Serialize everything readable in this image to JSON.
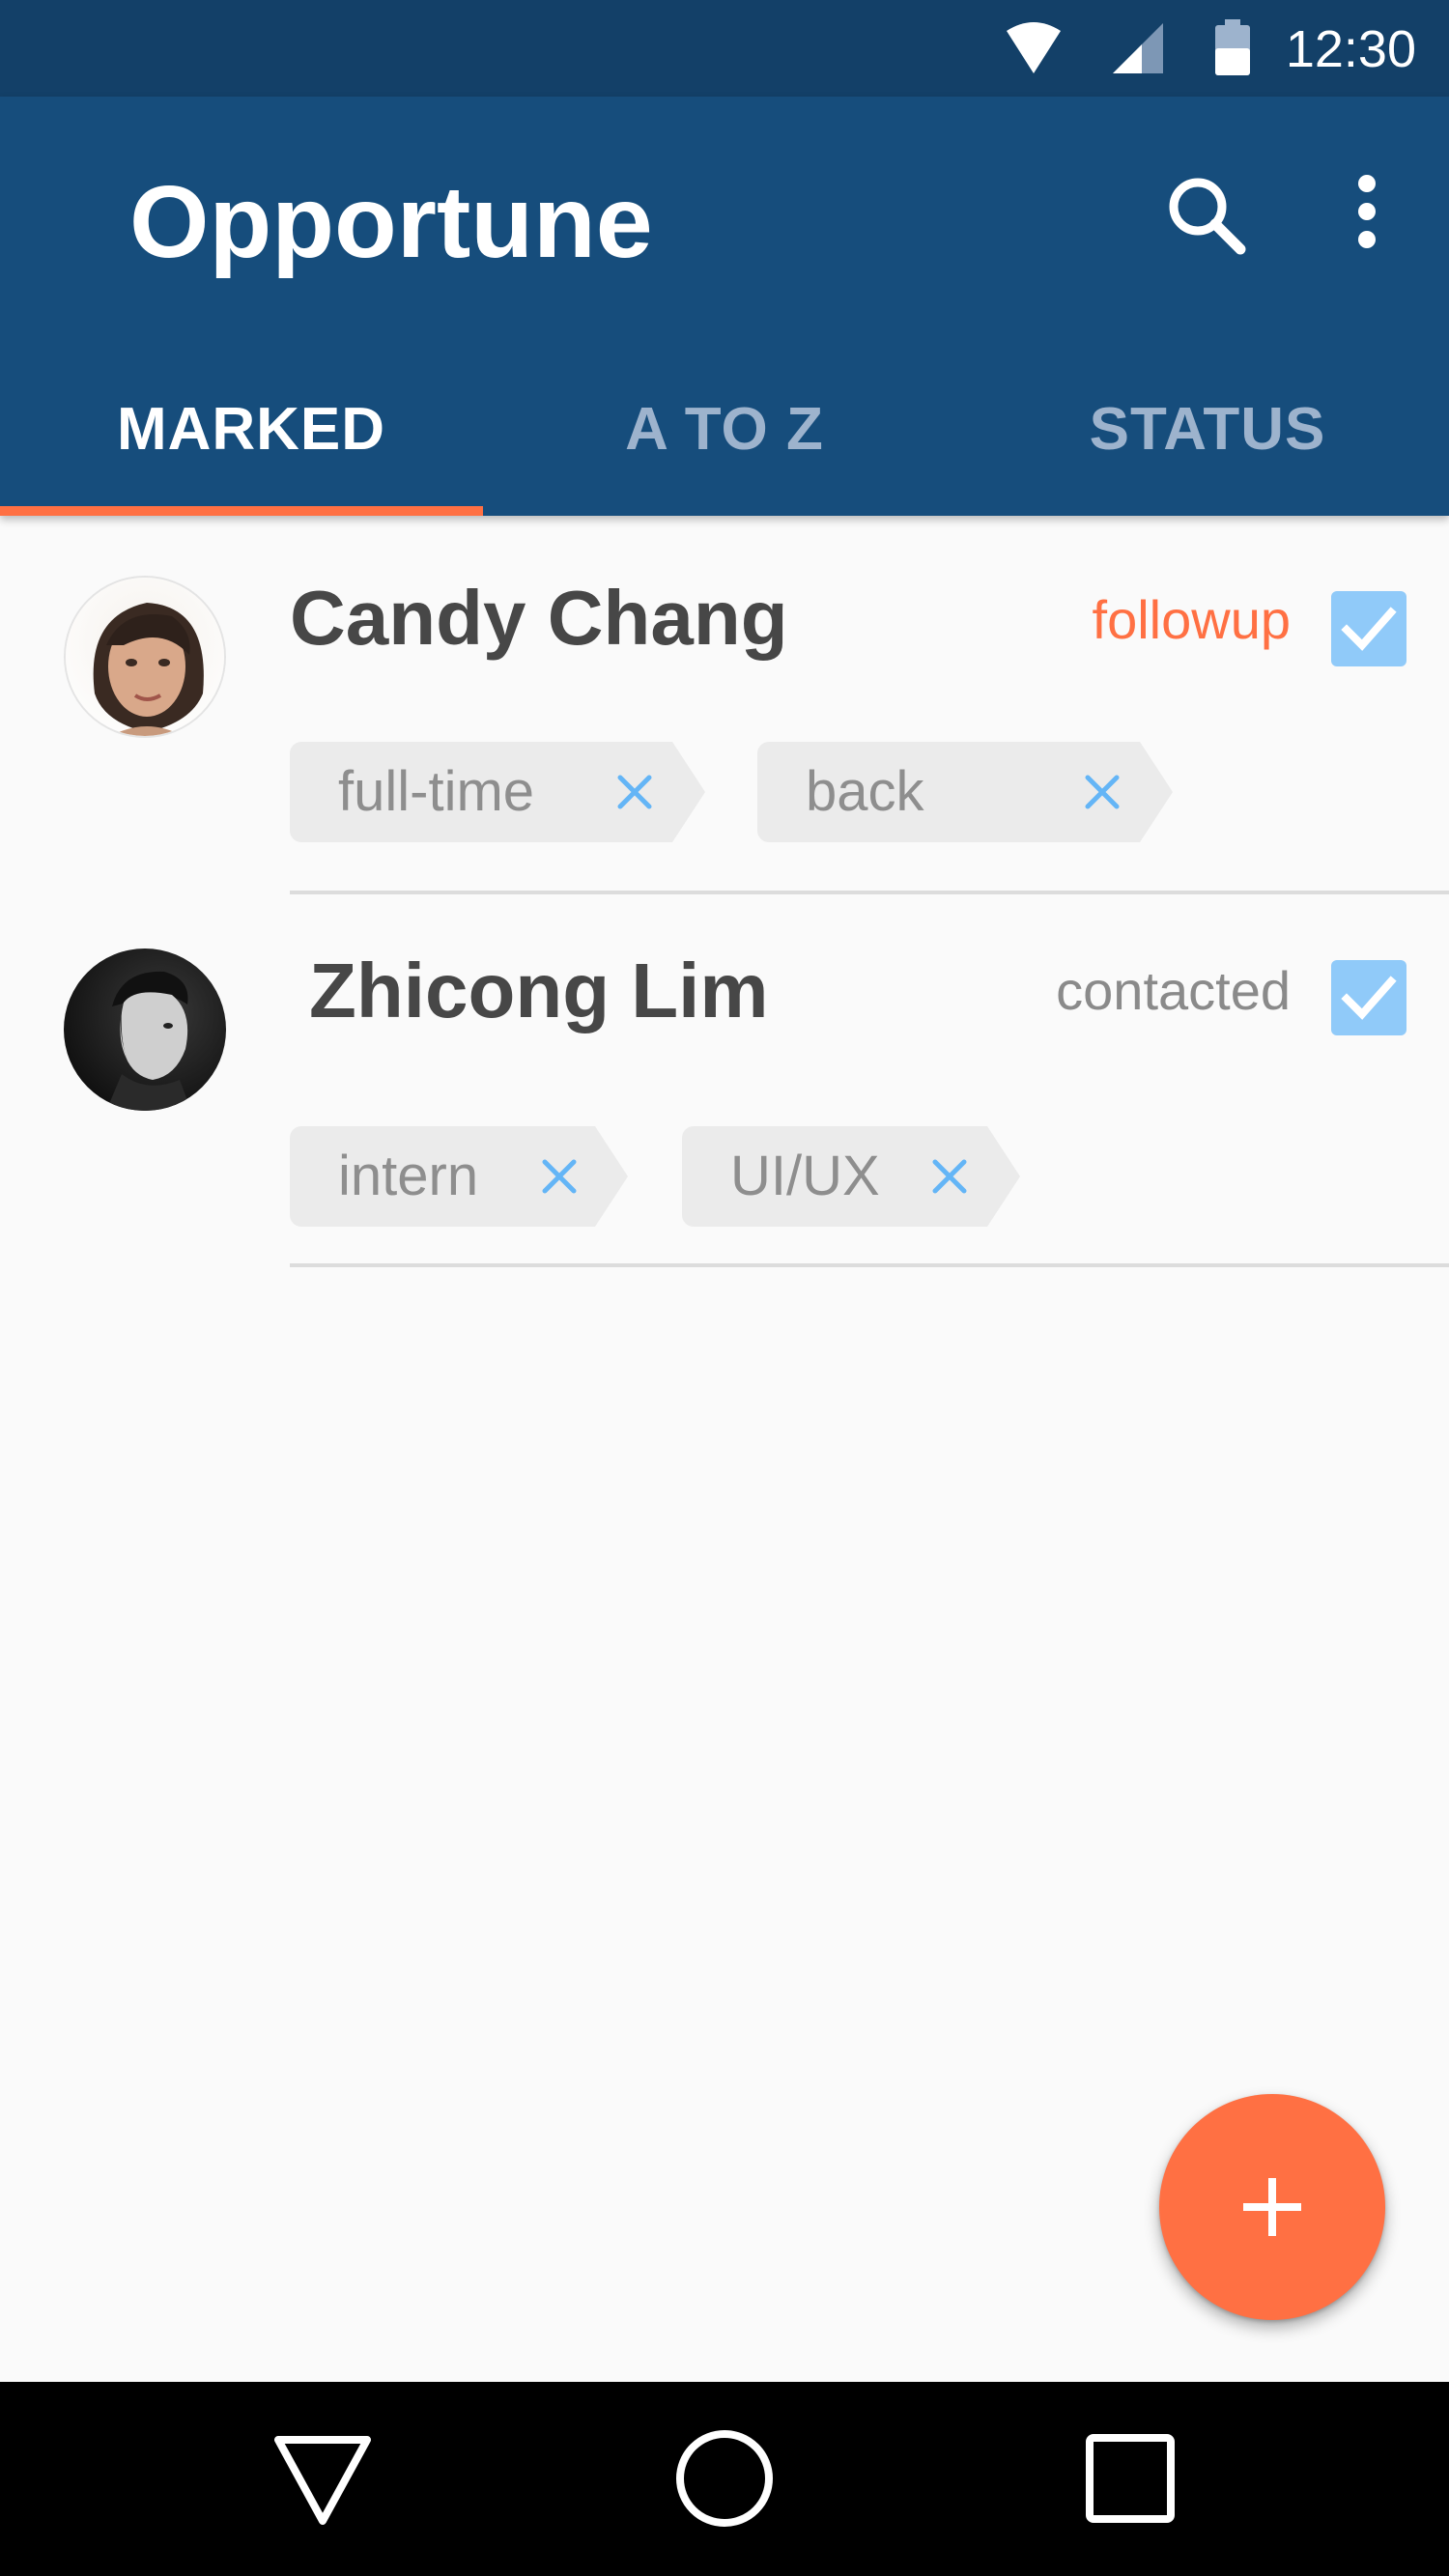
{
  "status_bar": {
    "time": "12:30",
    "icons": [
      "wifi-icon",
      "signal-icon",
      "battery-icon"
    ]
  },
  "app_bar": {
    "title": "Opportune",
    "actions": [
      "search-icon",
      "more-vert-icon"
    ]
  },
  "tabs": [
    {
      "label": "MARKED",
      "selected": true
    },
    {
      "label": "A TO Z",
      "selected": false
    },
    {
      "label": "STATUS",
      "selected": false
    }
  ],
  "contacts": [
    {
      "name": "Candy Chang",
      "status": "followup",
      "status_color": "#ff7043",
      "checked": true,
      "tags": [
        "full-time",
        "back"
      ]
    },
    {
      "name": "Zhicong Lim",
      "status": "contacted",
      "status_color": "#8a8a8a",
      "checked": true,
      "tags": [
        "intern",
        "UI/UX"
      ]
    }
  ],
  "fab": {
    "icon": "add-icon"
  },
  "colors": {
    "primary": "#164d7c",
    "primary_dark": "#134068",
    "accent": "#ff7043",
    "checkbox": "#90caf9",
    "tag_remove": "#64b5f6"
  },
  "nav_bar": {
    "buttons": [
      "back-icon",
      "home-icon",
      "recents-icon"
    ]
  }
}
